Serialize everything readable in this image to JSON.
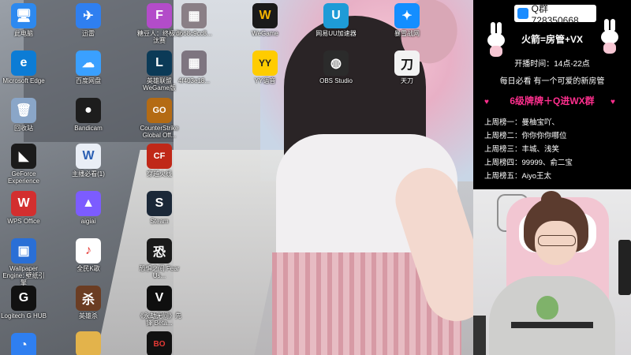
{
  "desktop": {
    "icons": [
      {
        "label": "此电脑",
        "icon": "computer-icon",
        "color": "#2d89ef",
        "glyph": "🖥"
      },
      {
        "label": "Microsoft Edge",
        "icon": "edge-icon",
        "color": "#0c7cd5",
        "glyph": "e"
      },
      {
        "label": "回收站",
        "icon": "recycle-bin-icon",
        "color": "#8aa6c8",
        "glyph": "🗑"
      },
      {
        "label": "GeForce Experience",
        "icon": "nvidia-icon",
        "color": "#1b1b1b",
        "glyph": "◣"
      },
      {
        "label": "WPS Office",
        "icon": "wps-icon",
        "color": "#d32f2f",
        "glyph": "W"
      },
      {
        "label": "Wallpaper Engine: 壁纸引擎",
        "icon": "wallpaper-engine-icon",
        "color": "#2a6fd6",
        "glyph": "▣"
      },
      {
        "label": "Logitech G HUB",
        "icon": "logitech-icon",
        "color": "#111111",
        "glyph": "G"
      },
      {
        "label": "迅雷",
        "icon": "thunder-icon",
        "color": "#2f7ff0",
        "glyph": "✈"
      },
      {
        "label": "百度网盘",
        "icon": "baidu-netdisk-icon",
        "color": "#3aa0ff",
        "glyph": "☁"
      },
      {
        "label": "Bandicam",
        "icon": "bandicam-icon",
        "color": "#1d1d1d",
        "glyph": "●"
      },
      {
        "label": "主播必看(1)",
        "icon": "document-icon",
        "color": "#e9eef6",
        "glyph": "W"
      },
      {
        "label": "aigiai",
        "icon": "aigiai-icon",
        "color": "#7c5cff",
        "glyph": "▲"
      },
      {
        "label": "全民K歌",
        "icon": "kge-icon",
        "color": "#ffffff",
        "glyph": "♪"
      },
      {
        "label": "英雄杀",
        "icon": "yingxiongsha-icon",
        "color": "#6b3d23",
        "glyph": "杀"
      },
      {
        "label": "",
        "icon": "partial-icon",
        "color": "#2f7ff0",
        "glyph": "◔"
      },
      {
        "label": "糖豆人：终极淘汰赛",
        "icon": "fall-guys-icon",
        "color": "#b34cc9",
        "glyph": "F"
      },
      {
        "label": "英雄联盟WeGame版",
        "icon": "lol-icon",
        "color": "#0b3a57",
        "glyph": "L"
      },
      {
        "label": "CounterStrike Global Off...",
        "icon": "csgo-icon",
        "color": "#b46b14",
        "glyph": "GO"
      },
      {
        "label": "穿越火线",
        "icon": "crossfire-icon",
        "color": "#c02818",
        "glyph": "CF"
      },
      {
        "label": "Steam",
        "icon": "steam-icon",
        "color": "#1b2838",
        "glyph": "S"
      },
      {
        "label": "恐惧之间 Fear Us...",
        "icon": "fear-icon",
        "color": "#1a1a1a",
        "glyph": "恐"
      },
      {
        "label": "《永劫无间》先锋 Beta...",
        "icon": "naraka-icon",
        "color": "#0f0f0f",
        "glyph": "V"
      },
      {
        "label": "",
        "icon": "black-ops-icon",
        "color": "#111111",
        "glyph": "BO"
      },
      {
        "label": "d668c9cc8...",
        "icon": "photo-icon",
        "color": "#8a7f86",
        "glyph": "▦"
      },
      {
        "label": "4f403e18...",
        "icon": "photo-icon",
        "color": "#7e7580",
        "glyph": "▦"
      },
      {
        "label": "WeGame",
        "icon": "wegame-icon",
        "color": "#1a1a1a",
        "glyph": "W"
      },
      {
        "label": "YY语音",
        "icon": "yy-icon",
        "color": "#ffcc00",
        "glyph": "YY"
      },
      {
        "label": "网易UU加速器",
        "icon": "uu-icon",
        "color": "#1e9bd7",
        "glyph": "U"
      },
      {
        "label": "OBS Studio",
        "icon": "obs-icon",
        "color": "#2b2b2b",
        "glyph": "◍"
      },
      {
        "label": "暴雪战网",
        "icon": "battlenet-icon",
        "color": "#148eff",
        "glyph": "✦"
      },
      {
        "label": "天刀",
        "icon": "tiandao-icon",
        "color": "#f2f2f2",
        "glyph": "刀"
      }
    ]
  },
  "overlay": {
    "qq_group": "Q群 728350668",
    "rules_line": "火箭=房管+VX",
    "broadcast_time": "开播时间：14点-22点",
    "daily_line": "每日必看 有一个可爱的新房管",
    "highlight_line": "6级牌牌＋Q进WX群",
    "rankings": [
      "上周榜一：曼柚宝吖、",
      "上周榜二：你你你你哪位",
      "上周榜三：丰城、浅笑",
      "上周榜四：99999、俞二宝",
      "上周榜五：Aiyo王太"
    ],
    "highlight_color": "#ff2f8e",
    "badge_color": "#1a8cff"
  }
}
